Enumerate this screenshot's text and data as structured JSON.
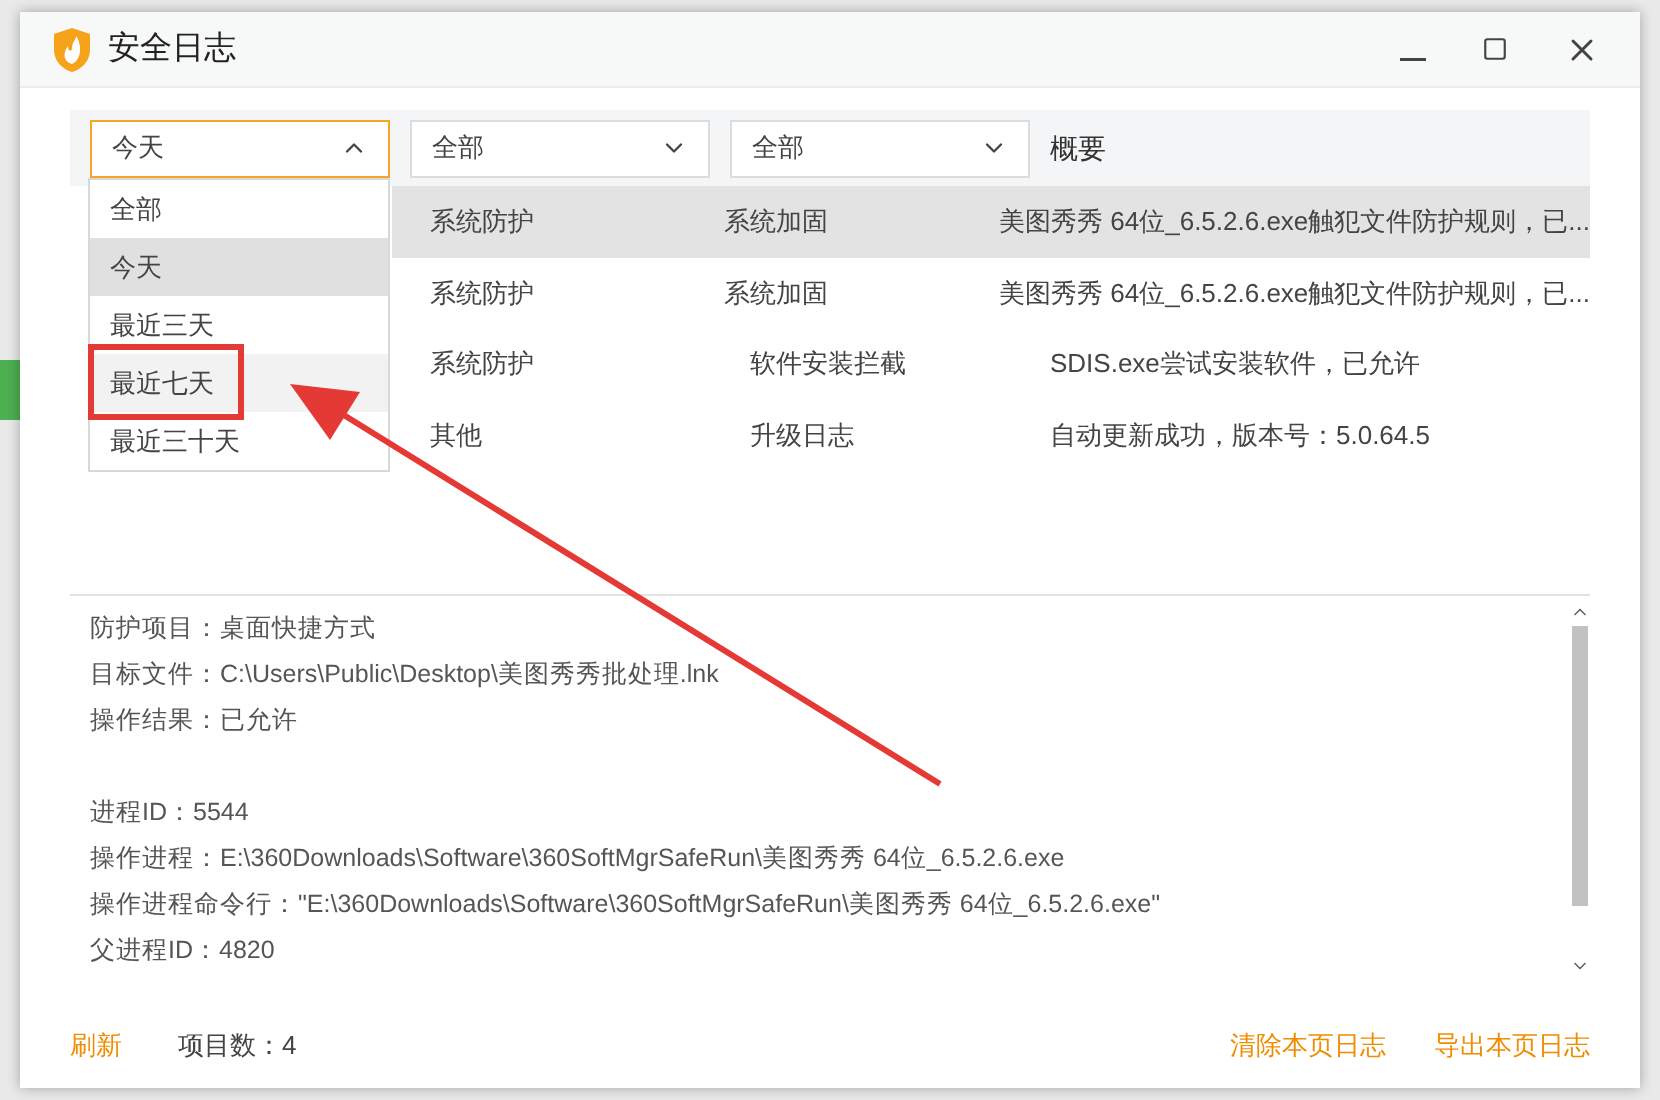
{
  "window": {
    "title": "安全日志"
  },
  "filters": [
    {
      "value": "今天",
      "expanded": true
    },
    {
      "value": "全部",
      "expanded": false
    },
    {
      "value": "全部",
      "expanded": false
    }
  ],
  "summary_heading": "概要",
  "dropdown_options": [
    {
      "label": "全部",
      "selected": false,
      "hovered": false
    },
    {
      "label": "今天",
      "selected": true,
      "hovered": false
    },
    {
      "label": "最近三天",
      "selected": false,
      "hovered": false
    },
    {
      "label": "最近七天",
      "selected": false,
      "hovered": true
    },
    {
      "label": "最近三十天",
      "selected": false,
      "hovered": false
    }
  ],
  "rows": [
    {
      "selected": true,
      "cells": [
        "系统防护",
        "系统加固",
        "美图秀秀 64位_6.5.2.6.exe触犯文件防护规则，已..."
      ]
    },
    {
      "selected": false,
      "cells": [
        "系统防护",
        "系统加固",
        "美图秀秀 64位_6.5.2.6.exe触犯文件防护规则，已..."
      ]
    },
    {
      "selected": false,
      "cells": [
        "系统防护",
        "软件安装拦截",
        "SDIS.exe尝试安装软件，已允许"
      ]
    },
    {
      "selected": false,
      "cells": [
        "其他",
        "升级日志",
        "自动更新成功，版本号：5.0.64.5"
      ]
    }
  ],
  "detail_groups": [
    [
      "防护项目：桌面快捷方式",
      "目标文件：C:\\Users\\Public\\Desktop\\美图秀秀批处理.lnk",
      "操作结果：已允许"
    ],
    [
      "进程ID：5544",
      "操作进程：E:\\360Downloads\\Software\\360SoftMgrSafeRun\\美图秀秀 64位_6.5.2.6.exe",
      "操作进程命令行：\"E:\\360Downloads\\Software\\360SoftMgrSafeRun\\美图秀秀 64位_6.5.2.6.exe\"",
      "父进程ID：4820"
    ]
  ],
  "footer": {
    "refresh": "刷新",
    "count": "项目数：4",
    "clear": "清除本页日志",
    "export": "导出本页日志"
  }
}
